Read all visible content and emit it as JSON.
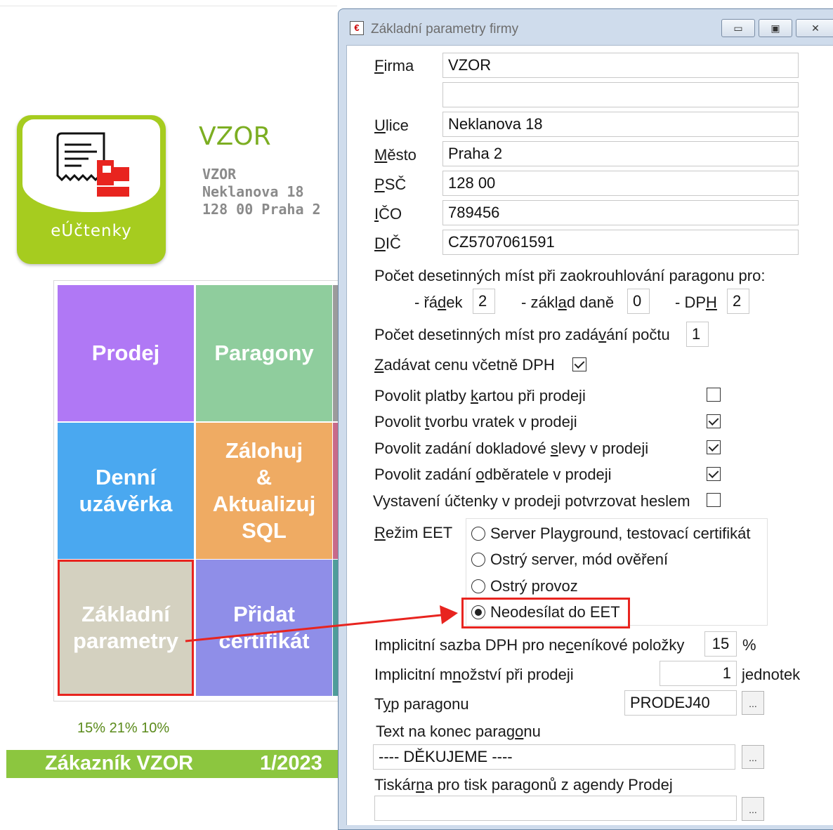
{
  "background": {
    "logo": {
      "label": "eÚčtenky"
    },
    "company": {
      "title": "VZOR",
      "line1": "VZOR",
      "line2": "Neklanova 18",
      "line3": "128 00 Praha 2"
    },
    "tiles": {
      "prodej": "Prodej",
      "paragony": "Paragony",
      "denni_l1": "Denní",
      "denni_l2": "uzávěrka",
      "zalohuj_l1": "Zálohuj",
      "zalohuj_l2": "&",
      "zalohuj_l3": "Aktualizuj",
      "zalohuj_l4": "SQL",
      "zakladni_l1": "Základní",
      "zakladni_l2": "parametry",
      "pridat_l1": "Přidat",
      "pridat_l2": "certifikát"
    },
    "vat_rates": "15% 21% 10%",
    "footer": {
      "customer": "Zákazník VZOR",
      "period": "1/2023"
    }
  },
  "dialog": {
    "title": "Základní parametry firmy",
    "fields": {
      "firma": {
        "label_u": "F",
        "label_rest": "irma",
        "value": "VZOR"
      },
      "firma2": {
        "value": ""
      },
      "ulice": {
        "label_u": "U",
        "label_rest": "lice",
        "value": "Neklanova 18"
      },
      "mesto": {
        "label_u": "M",
        "label_rest": "ěsto",
        "value": "Praha 2"
      },
      "psc": {
        "label_u": "P",
        "label_rest": "SČ",
        "value": "128 00"
      },
      "ico": {
        "label_u": "I",
        "label_rest": "ČO",
        "value": "789456"
      },
      "dic": {
        "label_u": "D",
        "label_rest": "IČ",
        "value": "CZ5707061591"
      }
    },
    "rounding": {
      "heading": "Počet desetinných míst při zaokrouhlování paragonu pro:",
      "radek_pre": "- řá",
      "radek_u": "d",
      "radek_post": "ek",
      "radek_value": "2",
      "zaklad_pre": "- zákl",
      "zaklad_u": "a",
      "zaklad_post": "d daně",
      "zaklad_value": "0",
      "dph_pre": "- DP",
      "dph_u": "H",
      "dph_value": "2"
    },
    "qty_decimals": {
      "pre": "Počet desetinných míst pro zadá",
      "u": "v",
      "post": "ání počtu",
      "value": "1"
    },
    "price_incl_vat": {
      "u": "Z",
      "rest": "adávat cenu včetně DPH",
      "checked": true
    },
    "options": [
      {
        "pre": "Povolit platby ",
        "u": "k",
        "post": "artou při prodeji",
        "checked": false
      },
      {
        "pre": "Povolit ",
        "u": "t",
        "post": "vorbu vratek v prodeji",
        "checked": true
      },
      {
        "pre": "Povolit zadání dokladové ",
        "u": "s",
        "post": "levy v prodeji",
        "checked": true
      },
      {
        "pre": "Povolit zadání ",
        "u": "o",
        "post": "dběratele v prodeji",
        "checked": true
      },
      {
        "pre": "Vystavení účtenky v prodeji potvrzovat heslem",
        "u": "",
        "post": "",
        "checked": false
      }
    ],
    "eet": {
      "label_u": "R",
      "label_rest": "ežim EET",
      "options": [
        "Server Playground, testovací certifikát",
        "Ostrý server, mód ověření",
        "Ostrý provoz",
        "Neodesílat do EET"
      ],
      "selected_index": 3
    },
    "vat_rate": {
      "pre": "Implicitní sazba DPH pro ne",
      "u": "c",
      "post": "eníkové položky",
      "value": "15",
      "unit": "%"
    },
    "default_qty": {
      "pre": "Implicitní m",
      "u": "n",
      "post": "ožství při prodeji",
      "value": "1",
      "unit": "jednotek"
    },
    "receipt_type": {
      "pre": "T",
      "u": "y",
      "post": "p paragonu",
      "value": "PRODEJ40",
      "browse": "..."
    },
    "end_text": {
      "pre": "Text na konec parag",
      "u": "o",
      "post": "nu",
      "value": "---- DĚKUJEME ----",
      "browse": "..."
    },
    "printer": {
      "pre": "Tiskár",
      "u": "n",
      "post": "a pro tisk paragonů z agendy Prodej",
      "value": "",
      "browse": "..."
    }
  },
  "colors": {
    "accent_green": "#8cc63f",
    "highlight_red": "#e8241f"
  }
}
